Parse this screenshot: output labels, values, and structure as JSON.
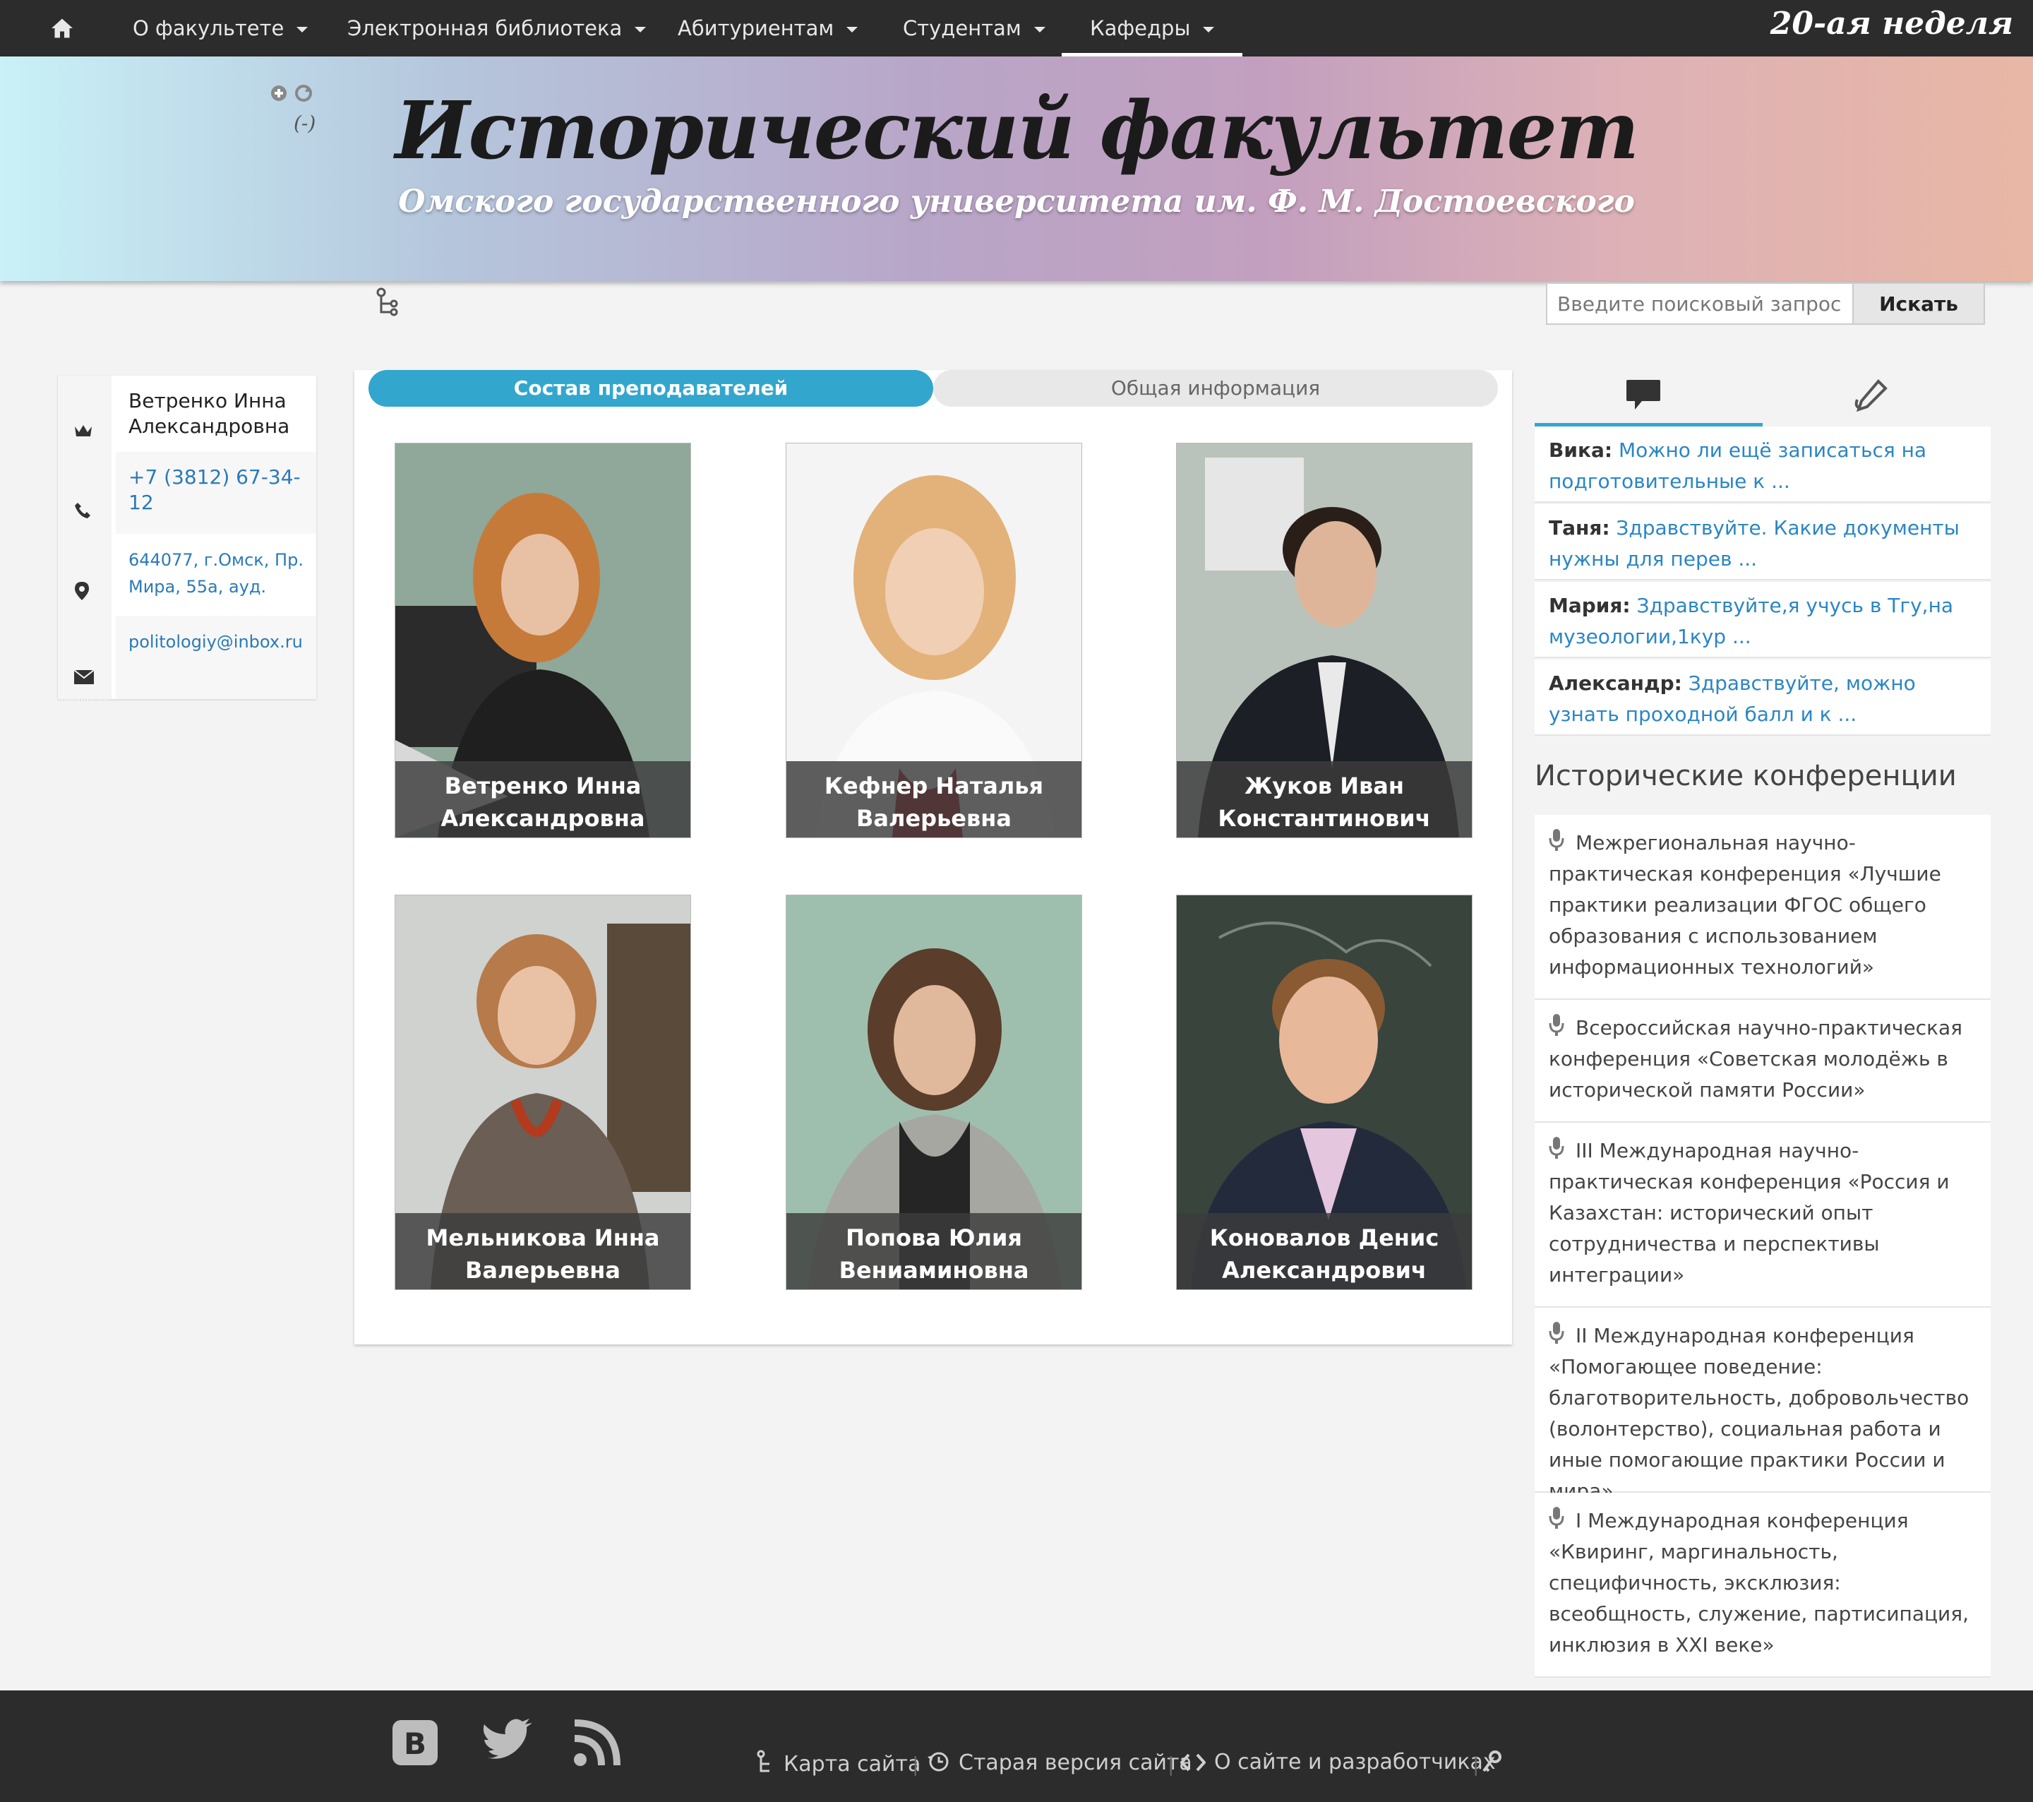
{
  "nav": {
    "items": [
      {
        "label": "О факультете"
      },
      {
        "label": "Электронная библиотека"
      },
      {
        "label": "Абитуриентам"
      },
      {
        "label": "Студентам"
      },
      {
        "label": "Кафедры"
      }
    ],
    "active": "Кафедры",
    "week": "20-ая неделя"
  },
  "banner": {
    "title": "Исторический факультет",
    "subtitle": "Омского государственного университета им. Ф. М. Достоевского",
    "minus": "(-)"
  },
  "search": {
    "placeholder": "Введите поисковый запрос",
    "button": "Искать"
  },
  "contact": {
    "name": "Ветренко Инна Александровна",
    "phone": "+7 (3812) 67-34-12",
    "address": "644077, г.Омск, Пр. Мира, 55а, ауд.",
    "email": "politologiy@inbox.ru"
  },
  "tabs": {
    "active": "Состав преподавателей",
    "inactive": "Общая информация"
  },
  "teachers": [
    {
      "line1": "Ветренко Инна",
      "line2": "Александровна"
    },
    {
      "line1": "Кефнер Наталья",
      "line2": "Валерьевна"
    },
    {
      "line1": "Жуков Иван",
      "line2": "Константинович"
    },
    {
      "line1": "Мельникова Инна",
      "line2": "Валерьевна"
    },
    {
      "line1": "Попова Юлия",
      "line2": "Вениаминовна"
    },
    {
      "line1": "Коновалов Денис",
      "line2": "Александрович"
    }
  ],
  "questions": [
    {
      "author": "Вика:",
      "text": "Можно ли ещё записаться на подготовительные к ..."
    },
    {
      "author": "Таня:",
      "text": "Здравствуйте. Какие документы нужны для перев ..."
    },
    {
      "author": "Мария:",
      "text": "Здравствуйте,я учусь в Тгу,на музеологии,1кур ..."
    },
    {
      "author": "Александр:",
      "text": "Здравствуйте, можно узнать проходной балл и к ..."
    }
  ],
  "conferences": {
    "heading": "Исторические конференции",
    "items": [
      "Межрегиональная научно-практическая конференция «Лучшие практики реализации ФГОС общего образования с использованием информационных технологий»",
      "Всероссийская научно-практическая конференция «Советская молодёжь в исторической памяти России»",
      "III Международная научно-практическая конференция «Россия и Казахстан: исторический опыт сотрудничества и перспективы интеграции»",
      "II Международная конференция «Помогающее поведение: благотворительность, добровольчество (волонтерство), социальная работа и иные помогающие практики России и мира»",
      "I Международная конференция «Квиринг, маргинальность, специфичность, эксклюзия: всеобщность, служение, партисипация, инклюзия в XXI веке»"
    ]
  },
  "footer": {
    "links": [
      "Карта сайта",
      "Старая версия сайта",
      "О сайте и разработчиках"
    ],
    "social_icons": [
      "vk-icon",
      "twitter-icon",
      "rss-icon"
    ]
  },
  "colors": {
    "accent": "#33a6ce",
    "nav_bg": "#2c2c2c",
    "link": "#2a7ab8"
  }
}
